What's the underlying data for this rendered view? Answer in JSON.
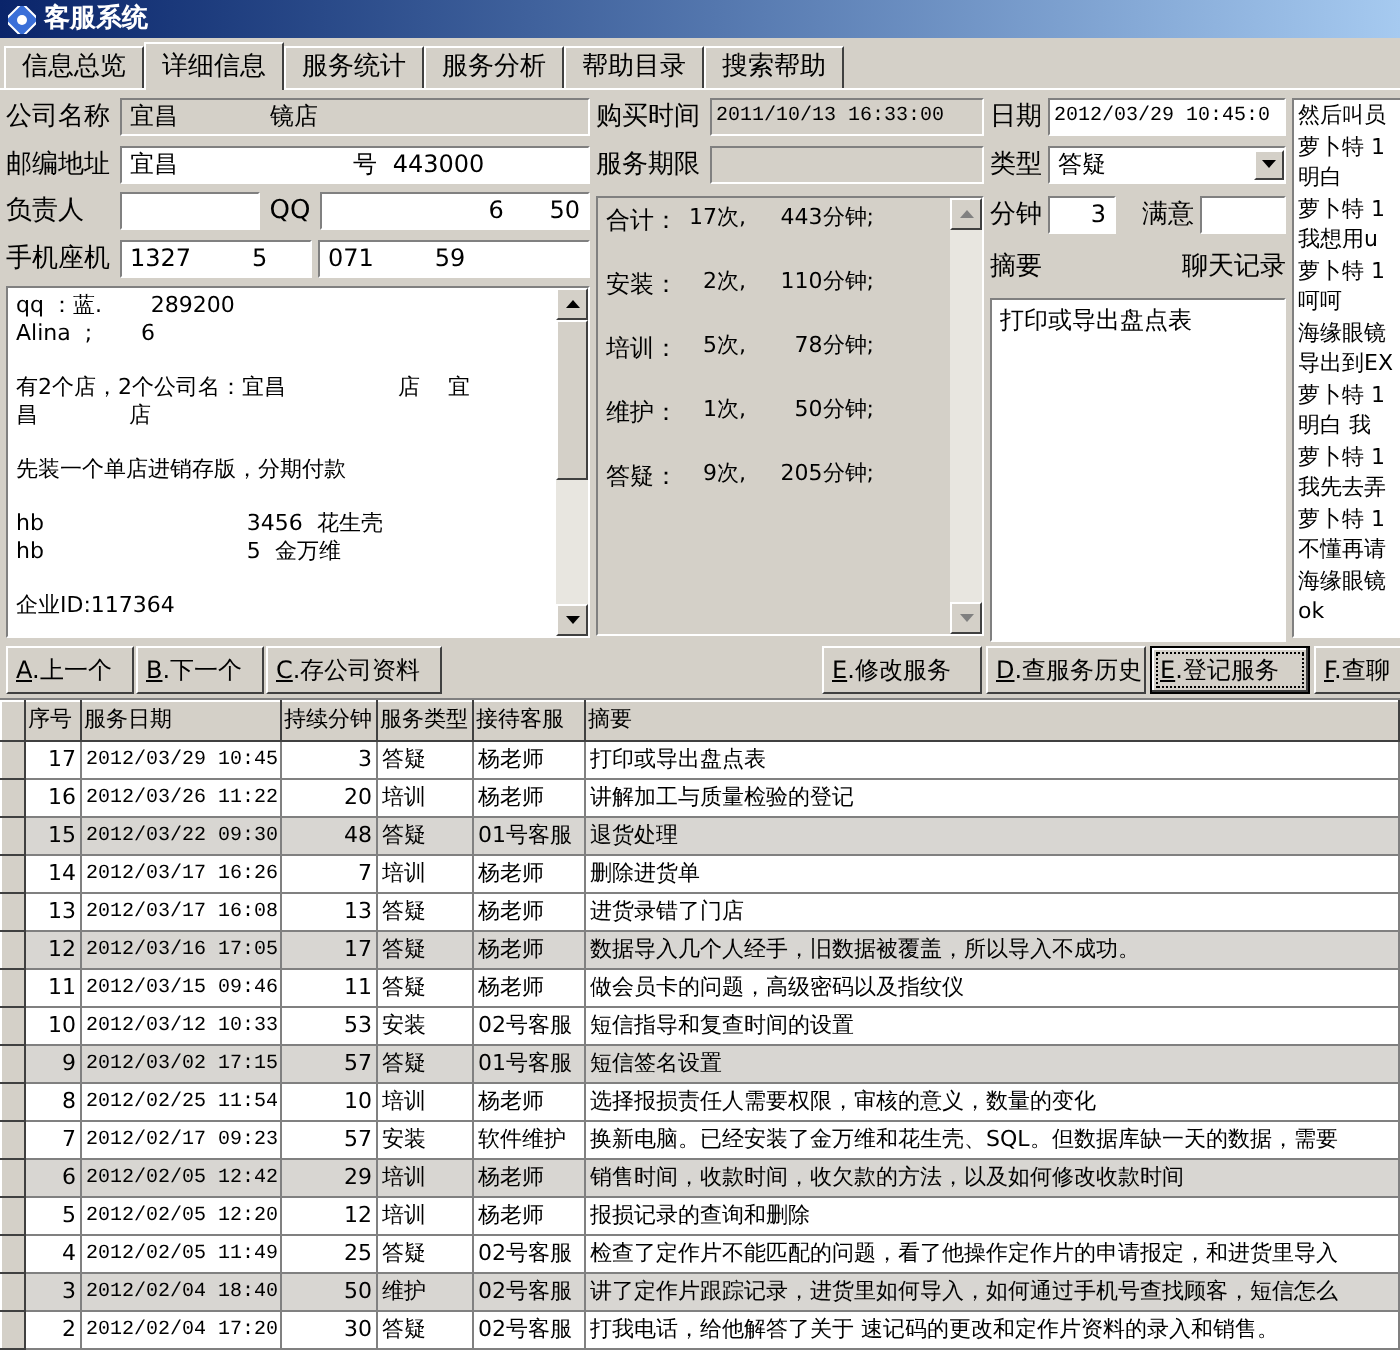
{
  "window": {
    "title": "客服系统"
  },
  "tabs": [
    {
      "label": "信息总览",
      "selected": false
    },
    {
      "label": "详细信息",
      "selected": true
    },
    {
      "label": "服务统计",
      "selected": false
    },
    {
      "label": "服务分析",
      "selected": false
    },
    {
      "label": "帮助目录",
      "selected": false
    },
    {
      "label": "搜索帮助",
      "selected": false
    }
  ],
  "company": {
    "name_label": "公司名称",
    "name": "宜昌            镜店",
    "address_label": "邮编地址",
    "address": "宜昌                       号  443000",
    "contact_label": "负责人",
    "qq_label": "QQ",
    "qq": "6      50",
    "phone_label": "手机座机",
    "mobile": "1327        5",
    "landline": "071        59"
  },
  "notes": [
    [
      "qq ：蓝.       289200",
      "Alina  ;       6"
    ],
    [
      "有2个店，2个公司名：宜昌                店    宜",
      "昌             店"
    ],
    [
      "先装一个单店进销存版，分期付款"
    ],
    [
      "hb                             3456  花生壳",
      "hb                             5  金万维"
    ],
    [
      "企业ID:117364"
    ]
  ],
  "purchase": {
    "label": "购买时间",
    "value": "2011/10/13 16:33:00"
  },
  "period": {
    "label": "服务期限"
  },
  "stats": [
    {
      "label": "合计：",
      "count": "17次,",
      "minutes": "443分钟;"
    },
    {
      "label": "安装：",
      "count": "2次,",
      "minutes": "110分钟;"
    },
    {
      "label": "培训：",
      "count": "5次,",
      "minutes": "78分钟;"
    },
    {
      "label": "维护：",
      "count": "1次,",
      "minutes": "50分钟;"
    },
    {
      "label": "答疑：",
      "count": "9次,",
      "minutes": "205分钟;"
    }
  ],
  "service": {
    "date_label": "日期",
    "date": "2012/03/29 10:45:0",
    "type_label": "类型",
    "type": "答疑",
    "minutes_label": "分钟",
    "minutes": "3",
    "satisfaction_label": "满意",
    "summary_label": "摘要",
    "chat_label": "聊天记录",
    "summary": "打印或导出盘点表"
  },
  "chat": [
    "然后叫员",
    "萝卜特 1",
    "明白",
    "萝卜特 1",
    "我想用u",
    "萝卜特 1",
    "呵呵",
    "海缘眼镜",
    "导出到EX",
    "萝卜特 1",
    "明白 我",
    "萝卜特 1",
    "我先去弄",
    "萝卜特 1",
    "不懂再请",
    "海缘眼镜",
    "ok"
  ],
  "left_buttons": [
    {
      "key": "A",
      "label": ".上一个",
      "focused": false
    },
    {
      "key": "B",
      "label": ".下一个",
      "focused": false
    },
    {
      "key": "C",
      "label": ".存公司资料",
      "focused": false
    }
  ],
  "right_buttons": [
    {
      "key": "E",
      "label": ".修改服务",
      "focused": false
    },
    {
      "key": "D",
      "label": ".查服务历史",
      "focused": false
    },
    {
      "key": "E",
      "label": ".登记服务",
      "focused": true
    },
    {
      "key": "F",
      "label": ".查聊",
      "focused": false
    }
  ],
  "table": {
    "columns": [
      "序号",
      "服务日期",
      "持续分钟",
      "服务类型",
      "接待客服",
      "摘要"
    ],
    "rows": [
      {
        "cells": [
          "17",
          "2012/03/29 10:45",
          "3",
          "答疑",
          "杨老师",
          "打印或导出盘点表"
        ],
        "shaded": false
      },
      {
        "cells": [
          "16",
          "2012/03/26 11:22",
          "20",
          "培训",
          "杨老师",
          "讲解加工与质量检验的登记"
        ],
        "shaded": false
      },
      {
        "cells": [
          "15",
          "2012/03/22 09:30",
          "48",
          "答疑",
          "01号客服",
          "退货处理"
        ],
        "shaded": true
      },
      {
        "cells": [
          "14",
          "2012/03/17 16:26",
          "7",
          "培训",
          "杨老师",
          "删除进货单"
        ],
        "shaded": false
      },
      {
        "cells": [
          "13",
          "2012/03/17 16:08",
          "13",
          "答疑",
          "杨老师",
          "进货录错了门店"
        ],
        "shaded": false
      },
      {
        "cells": [
          "12",
          "2012/03/16 17:05",
          "17",
          "答疑",
          "杨老师",
          "数据导入几个人经手，旧数据被覆盖，所以导入不成功。"
        ],
        "shaded": true
      },
      {
        "cells": [
          "11",
          "2012/03/15 09:46",
          "11",
          "答疑",
          "杨老师",
          "做会员卡的问题，高级密码以及指纹仪"
        ],
        "shaded": false
      },
      {
        "cells": [
          "10",
          "2012/03/12 10:33",
          "53",
          "安装",
          "02号客服",
          "短信指导和复查时间的设置"
        ],
        "shaded": false
      },
      {
        "cells": [
          "9",
          "2012/03/02 17:15",
          "57",
          "答疑",
          "01号客服",
          "短信签名设置"
        ],
        "shaded": true
      },
      {
        "cells": [
          "8",
          "2012/02/25 11:54",
          "10",
          "培训",
          "杨老师",
          "选择报损责任人需要权限，审核的意义，数量的变化"
        ],
        "shaded": false
      },
      {
        "cells": [
          "7",
          "2012/02/17 09:23",
          "57",
          "安装",
          "软件维护",
          "换新电脑。已经安装了金万维和花生壳、SQL。但数据库缺一天的数据，需要"
        ],
        "shaded": false
      },
      {
        "cells": [
          "6",
          "2012/02/05 12:42",
          "29",
          "培训",
          "杨老师",
          "销售时间，收款时间，收欠款的方法，以及如何修改收款时间"
        ],
        "shaded": true
      },
      {
        "cells": [
          "5",
          "2012/02/05 12:20",
          "12",
          "培训",
          "杨老师",
          "报损记录的查询和删除"
        ],
        "shaded": false
      },
      {
        "cells": [
          "4",
          "2012/02/05 11:49",
          "25",
          "答疑",
          "02号客服",
          "检查了定作片不能匹配的问题，看了他操作定作片的申请报定，和进货里导入"
        ],
        "shaded": false
      },
      {
        "cells": [
          "3",
          "2012/02/04 18:40",
          "50",
          "维护",
          "02号客服",
          "讲了定作片跟踪记录，进货里如何导入，如何通过手机号查找顾客，短信怎么"
        ],
        "shaded": true
      },
      {
        "cells": [
          "2",
          "2012/02/04 17:20",
          "30",
          "答疑",
          "02号客服",
          "打我电话，给他解答了关于 速记码的更改和定作片资料的录入和销售。"
        ],
        "shaded": false
      }
    ]
  }
}
